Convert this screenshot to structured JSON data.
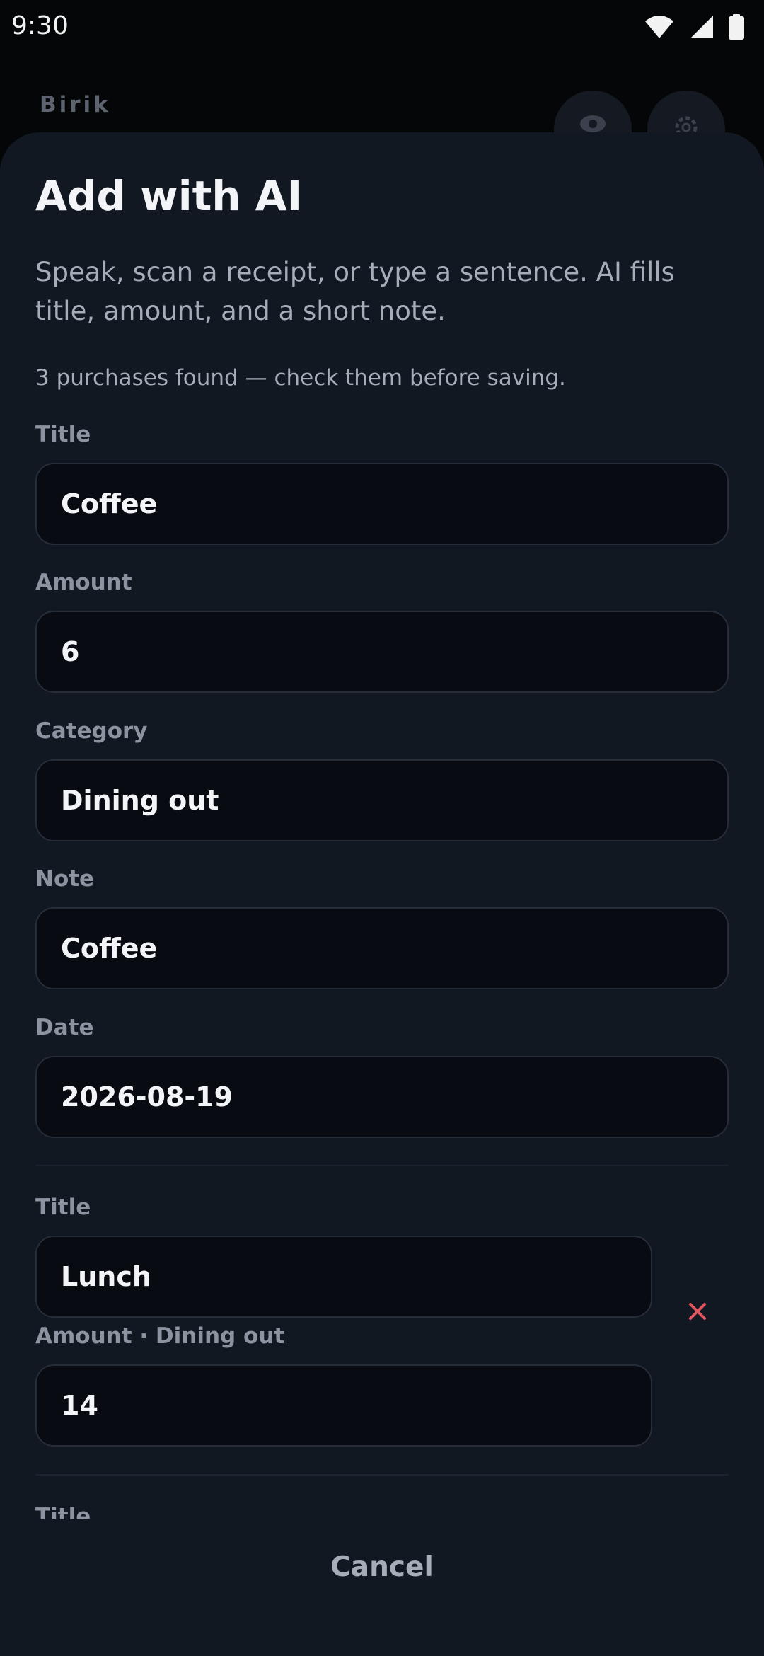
{
  "status_bar": {
    "time": "9:30",
    "icons": [
      "wifi-icon",
      "signal-icon",
      "battery-icon"
    ]
  },
  "background_app": {
    "title": "Birik",
    "actions": [
      "eye-icon",
      "gear-icon"
    ]
  },
  "sheet": {
    "title": "Add with AI",
    "description": "Speak, scan a receipt, or type a sentence. AI fills title, amount, and a short note.",
    "found_note": "3 purchases found — check them before saving.",
    "purchase1": {
      "title_label": "Title",
      "title_value": "Coffee",
      "amount_label": "Amount",
      "amount_value": "6",
      "category_label": "Category",
      "category_value": "Dining out",
      "note_label": "Note",
      "note_value": "Coffee",
      "date_label": "Date",
      "date_value": "2026-08-19"
    },
    "purchase2": {
      "title_label": "Title",
      "title_value": "Lunch",
      "amount_label": "Amount · Dining out",
      "amount_value": "14",
      "remove_icon": "close-icon"
    },
    "purchase3": {
      "title_label": "Title"
    },
    "cancel_label": "Cancel"
  },
  "colors": {
    "sheet_background": "#121822",
    "field_background": "#080b11",
    "remove_accent": "#e0565f",
    "primary_text": "#f2f4f7",
    "secondary_text": "#a6adb9"
  }
}
